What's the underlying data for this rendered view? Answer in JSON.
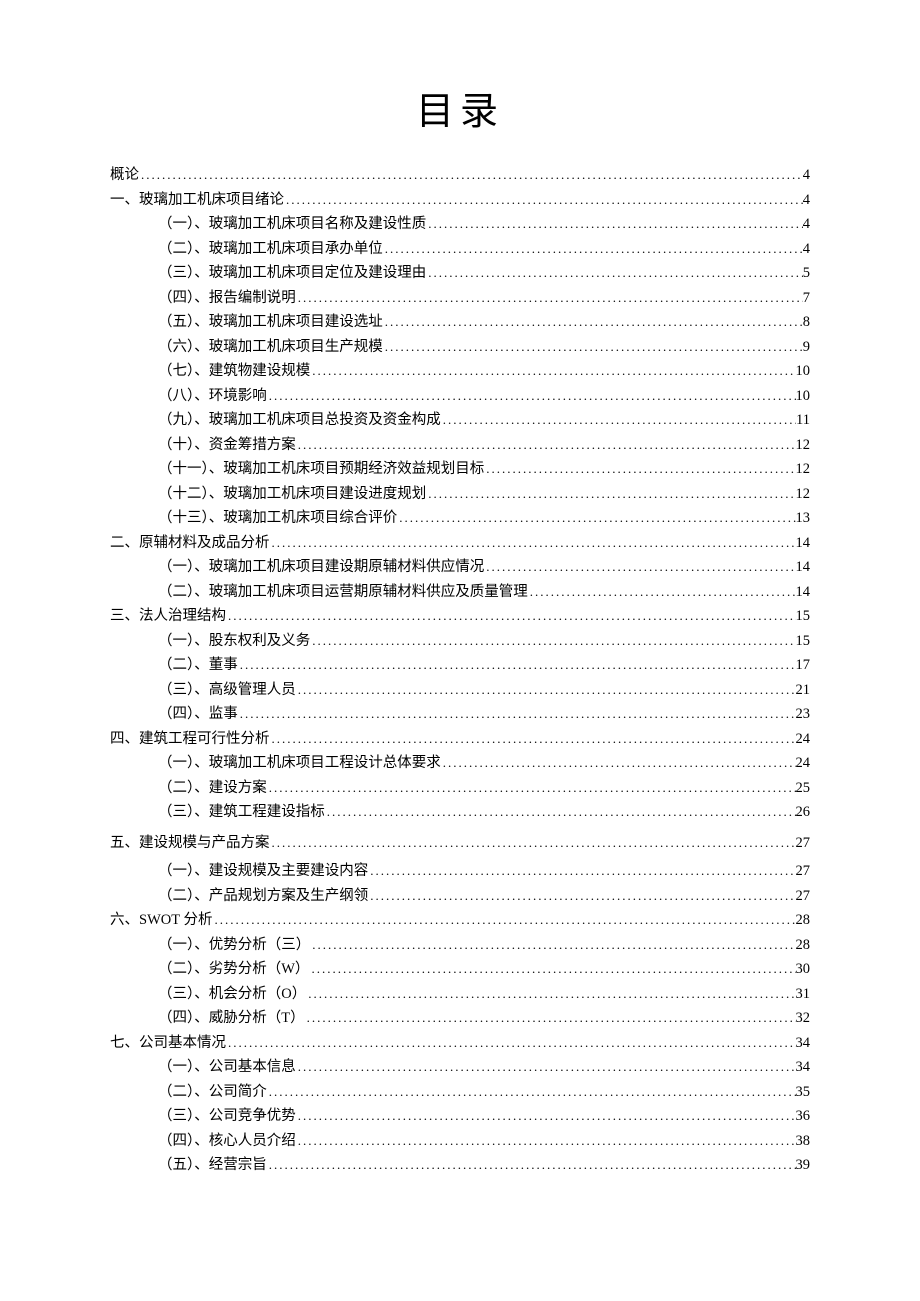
{
  "title": "目录",
  "toc": [
    {
      "level": 1,
      "label": "概论",
      "page": "4"
    },
    {
      "level": 1,
      "label": "一、玻璃加工机床项目绪论",
      "page": "4"
    },
    {
      "level": 2,
      "label": "（一）、玻璃加工机床项目名称及建设性质",
      "page": "4"
    },
    {
      "level": 2,
      "label": "（二）、玻璃加工机床项目承办单位",
      "page": "4"
    },
    {
      "level": 2,
      "label": "（三）、玻璃加工机床项目定位及建设理由",
      "page": "5"
    },
    {
      "level": 2,
      "label": "（四）、报告编制说明",
      "page": "7"
    },
    {
      "level": 2,
      "label": "（五）、玻璃加工机床项目建设选址",
      "page": "8"
    },
    {
      "level": 2,
      "label": "（六）、玻璃加工机床项目生产规模",
      "page": "9"
    },
    {
      "level": 2,
      "label": "（七）、建筑物建设规模",
      "page": "10"
    },
    {
      "level": 2,
      "label": "（八）、环境影响",
      "page": "10"
    },
    {
      "level": 2,
      "label": "（九）、玻璃加工机床项目总投资及资金构成",
      "page": "11"
    },
    {
      "level": 2,
      "label": "（十）、资金筹措方案",
      "page": "12"
    },
    {
      "level": 2,
      "label": "（十一）、玻璃加工机床项目预期经济效益规划目标",
      "page": "12"
    },
    {
      "level": 2,
      "label": "（十二）、玻璃加工机床项目建设进度规划",
      "page": "12"
    },
    {
      "level": 2,
      "label": "（十三）、玻璃加工机床项目综合评价",
      "page": "13"
    },
    {
      "level": 1,
      "label": "二、原辅材料及成品分析",
      "page": "14"
    },
    {
      "level": 2,
      "label": "（一）、玻璃加工机床项目建设期原辅材料供应情况",
      "page": "14"
    },
    {
      "level": 2,
      "label": "（二）、玻璃加工机床项目运营期原辅材料供应及质量管理",
      "page": "14"
    },
    {
      "level": 1,
      "label": "三、法人治理结构",
      "page": "15"
    },
    {
      "level": 2,
      "label": "（一）、股东权利及义务",
      "page": "15"
    },
    {
      "level": 2,
      "label": "（二）、董事",
      "page": "17"
    },
    {
      "level": 2,
      "label": "（三）、高级管理人员",
      "page": "21"
    },
    {
      "level": 2,
      "label": "（四）、监事",
      "page": "23"
    },
    {
      "level": 1,
      "label": "四、建筑工程可行性分析",
      "page": "24"
    },
    {
      "level": 2,
      "label": "（一）、玻璃加工机床项目工程设计总体要求",
      "page": "24"
    },
    {
      "level": 2,
      "label": "（二）、建设方案",
      "page": "25"
    },
    {
      "level": 2,
      "label": "（三）、建筑工程建设指标",
      "page": "26"
    },
    {
      "level": 1,
      "spaced": true,
      "label": "五、建设规模与产品方案",
      "page": "27"
    },
    {
      "level": 2,
      "label": "（一）、建设规模及主要建设内容",
      "page": "27"
    },
    {
      "level": 2,
      "label": "（二）、产品规划方案及生产纲领",
      "page": "27"
    },
    {
      "level": 1,
      "label": "六、SWOT 分析",
      "page": "28"
    },
    {
      "level": 2,
      "label": "（一）、优势分析（三）",
      "page": "28"
    },
    {
      "level": 2,
      "label": "（二）、劣势分析（W）",
      "page": "30"
    },
    {
      "level": 2,
      "label": "（三）、机会分析（O）",
      "page": "31"
    },
    {
      "level": 2,
      "label": "（四）、威胁分析（T）",
      "page": "32"
    },
    {
      "level": 1,
      "label": "七、公司基本情况",
      "page": "34"
    },
    {
      "level": 2,
      "label": "（一）、公司基本信息",
      "page": "34"
    },
    {
      "level": 2,
      "label": "（二）、公司简介",
      "page": "35"
    },
    {
      "level": 2,
      "label": "（三）、公司竞争优势",
      "page": "36"
    },
    {
      "level": 2,
      "label": "（四）、核心人员介绍",
      "page": "38"
    },
    {
      "level": 2,
      "label": "（五）、经营宗旨",
      "page": "39"
    }
  ]
}
